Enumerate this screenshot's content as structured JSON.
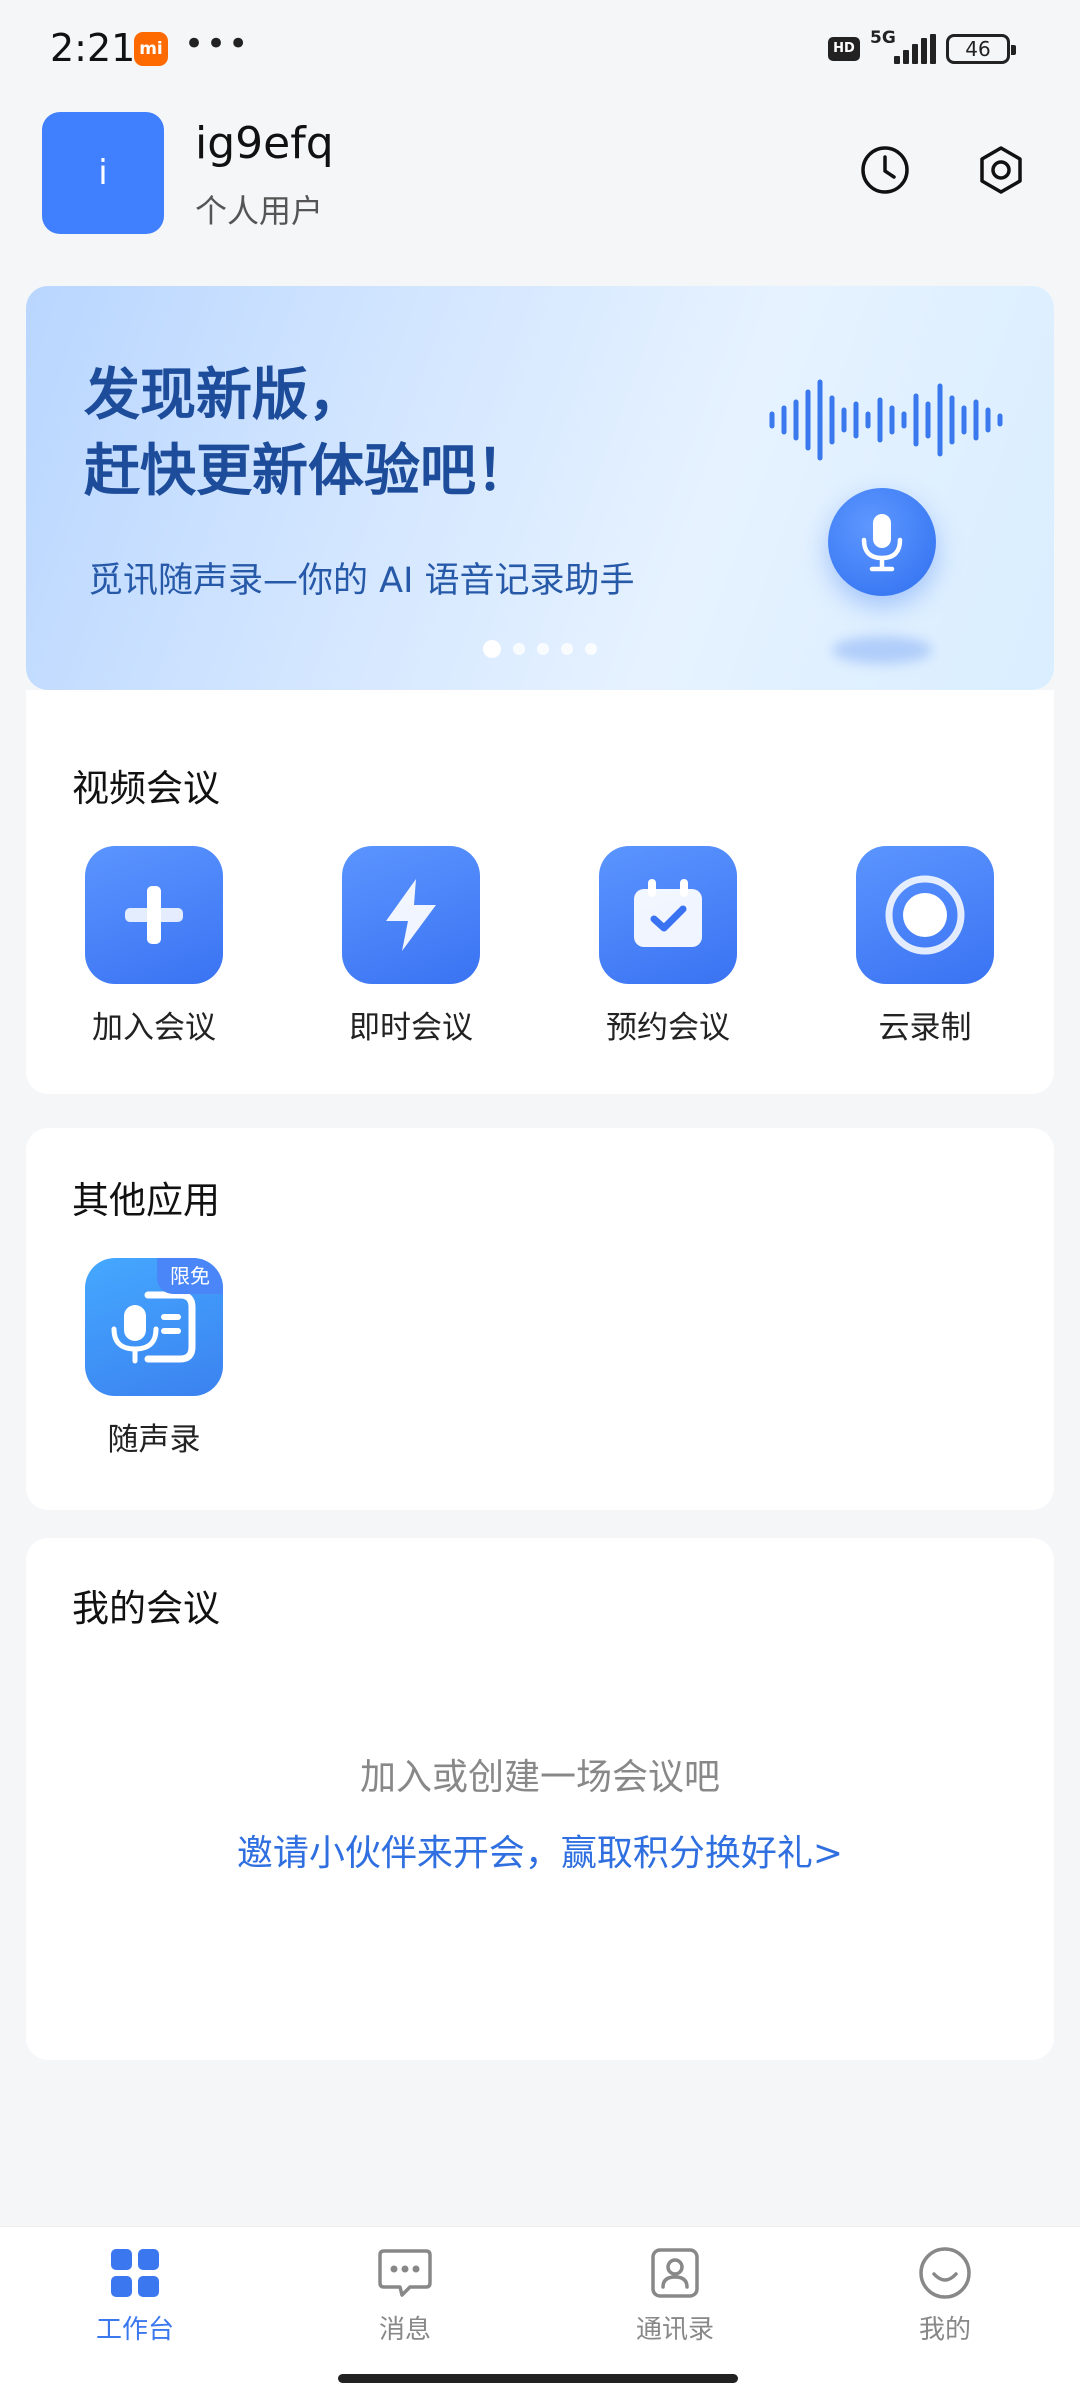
{
  "status_bar": {
    "time": "2:21",
    "mi_badge": "mi",
    "more_dots": "•••",
    "hd_label": "HD",
    "network": "5G",
    "battery": "46"
  },
  "header": {
    "avatar_text": "i",
    "username": "ig9efq",
    "user_type": "个人用户",
    "icons": [
      "clock-icon",
      "settings-icon"
    ]
  },
  "banner": {
    "title": "发现新版，\n赶快更新体验吧！",
    "subtitle": "觅讯随声录—你的 AI 语音记录助手",
    "slide_count": 5,
    "active_slide": 1
  },
  "video_meeting": {
    "title": "视频会议",
    "actions": [
      {
        "label": "加入会议",
        "icon": "plus-icon"
      },
      {
        "label": "即时会议",
        "icon": "lightning-icon"
      },
      {
        "label": "预约会议",
        "icon": "calendar-check-icon"
      },
      {
        "label": "云录制",
        "icon": "record-icon"
      }
    ]
  },
  "other_apps": {
    "title": "其他应用",
    "apps": [
      {
        "label": "随声录",
        "badge": "限免",
        "icon": "voice-recorder-icon"
      }
    ]
  },
  "my_meetings": {
    "title": "我的会议",
    "empty_text": "加入或创建一场会议吧",
    "invite_link": "邀请小伙伴来开会，赢取积分换好礼>"
  },
  "bottom_nav": {
    "active_index": 0,
    "items": [
      {
        "label": "工作台",
        "icon": "workbench-icon"
      },
      {
        "label": "消息",
        "icon": "message-icon"
      },
      {
        "label": "通讯录",
        "icon": "contacts-icon"
      },
      {
        "label": "我的",
        "icon": "profile-icon"
      }
    ]
  },
  "colors": {
    "accent": "#3b78f0",
    "avatar_bg": "#4080ff",
    "banner_title": "#1d4c9b",
    "link": "#2f6fe0"
  }
}
